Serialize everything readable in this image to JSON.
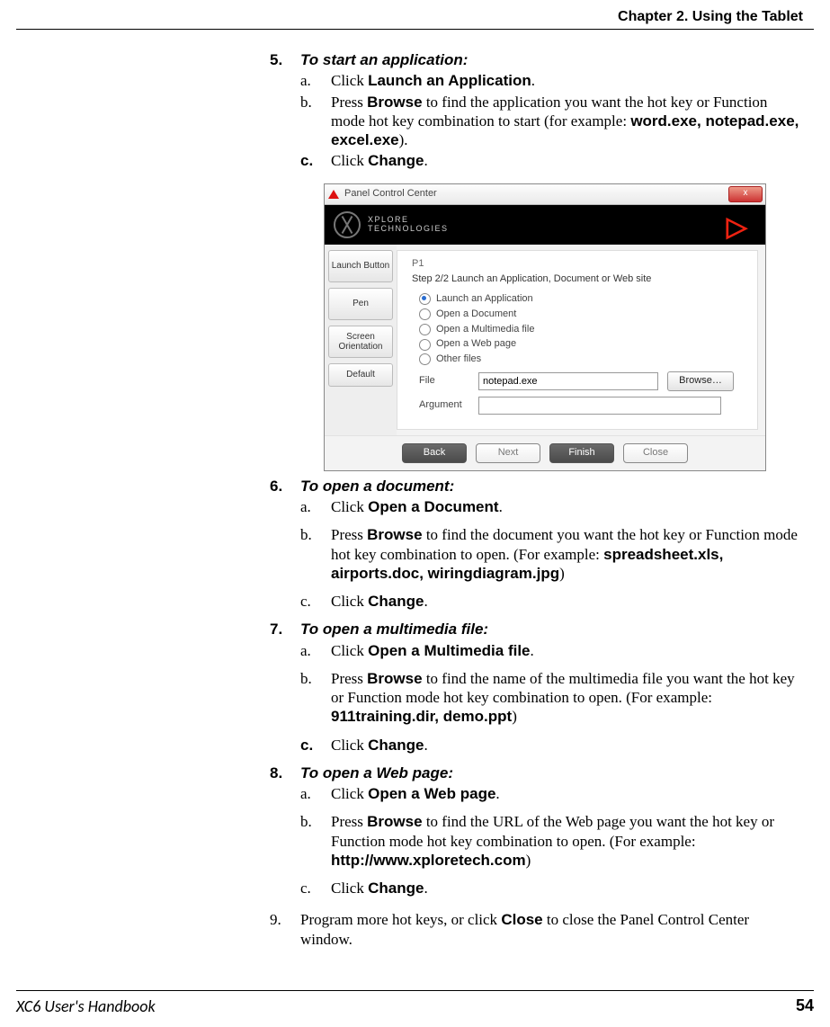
{
  "header": {
    "chapter": "Chapter 2. Using the Tablet"
  },
  "footer": {
    "book": "XC6 User's Handbook",
    "page": "54"
  },
  "step5": {
    "num": "5.",
    "title": "To start an application:",
    "a_let": "a.",
    "a_pre": "Click ",
    "a_bold": "Launch an Application",
    "a_post": ".",
    "b_let": "b.",
    "b_pre": "Press ",
    "b_bold1": "Browse",
    "b_mid": " to find the application you want the hot key or Function mode hot key combination to start (for example: ",
    "b_bold2": "word.exe, notepad.exe, excel.exe",
    "b_post": ").",
    "c_let": "c.",
    "c_pre": "Click ",
    "c_bold": "Change",
    "c_post": "."
  },
  "screenshot": {
    "title": "Panel Control Center",
    "close_x": "x",
    "brand_line1": "XPLORE",
    "brand_line2": "TECHNOLOGIES",
    "play": "▷",
    "tabs": {
      "launch": "Launch Button",
      "pen": "Pen",
      "screen": "Screen Orientation",
      "default": "Default"
    },
    "p1": "P1",
    "step": "Step 2/2     Launch an Application, Document or Web site",
    "opt1": "Launch an Application",
    "opt2": "Open a Document",
    "opt3": "Open a Multimedia file",
    "opt4": "Open a Web page",
    "opt5": "Other files",
    "file_label": "File",
    "file_value": "notepad.exe",
    "browse": "Browse…",
    "arg_label": "Argument",
    "back": "Back",
    "next": "Next",
    "finish": "Finish",
    "closebtn": "Close"
  },
  "step6": {
    "num": "6.",
    "title": "To open a document:",
    "a_let": "a.",
    "a_pre": "Click ",
    "a_bold": "Open a Document",
    "a_post": ".",
    "b_let": "b.",
    "b_pre": "Press ",
    "b_bold1": "Browse",
    "b_mid": " to find the document you want the hot key or Function mode hot key combination to open. (For example: ",
    "b_bold2": "spreadsheet.xls, airports.doc, wiringdiagram.jpg",
    "b_post": ")",
    "c_let": "c.",
    "c_pre": "Click ",
    "c_bold": "Change",
    "c_post": "."
  },
  "step7": {
    "num": "7.",
    "title": "To open a multimedia file:",
    "a_let": "a.",
    "a_pre": "Click ",
    "a_bold": "Open a Multimedia file",
    "a_post": ".",
    "b_let": "b.",
    "b_pre": "Press ",
    "b_bold1": "Browse",
    "b_mid": " to find the name of the multimedia file you want the hot key or Function mode hot key combination to open. (For example: ",
    "b_bold2": "911training.dir, demo.ppt",
    "b_post": ")",
    "c_let": "c.",
    "c_pre": "Click ",
    "c_bold": "Change",
    "c_post": "."
  },
  "step8": {
    "num": "8.",
    "title": "To open a Web page:",
    "a_let": "a.",
    "a_pre": "Click ",
    "a_bold": "Open a Web page",
    "a_post": ".",
    "b_let": "b.",
    "b_pre": "Press ",
    "b_bold1": "Browse",
    "b_mid": " to find the URL of the Web page you want the hot key or Function mode hot key combination to open. (For example: ",
    "b_bold2": "http://www.xploretech.com",
    "b_post": ")",
    "c_let": "c.",
    "c_pre": "Click ",
    "c_bold": "Change",
    "c_post": "."
  },
  "step9": {
    "num": "9.",
    "pre": "Program more hot keys, or click ",
    "bold": "Close",
    "post": " to close the Panel Control Center window."
  }
}
